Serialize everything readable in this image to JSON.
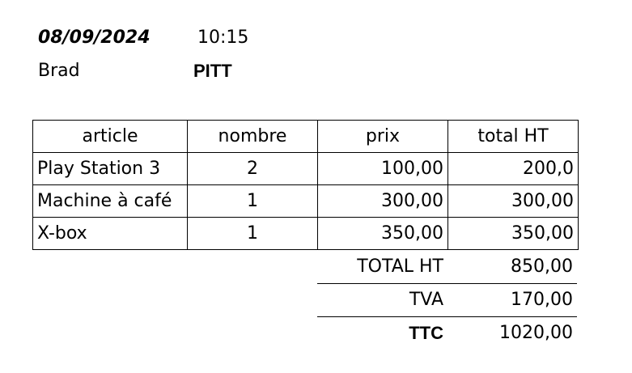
{
  "header": {
    "date": "08/09/2024",
    "time": "10:15",
    "first_name": "Brad",
    "last_name": "PITT"
  },
  "table": {
    "columns": [
      "article",
      "nombre",
      "prix",
      "total HT"
    ],
    "rows": [
      {
        "article": "Play Station 3",
        "nombre": "2",
        "prix": "100,00",
        "total": "200,0"
      },
      {
        "article": "Machine à café",
        "nombre": "1",
        "prix": "300,00",
        "total": "300,00"
      },
      {
        "article": "X-box",
        "nombre": "1",
        "prix": "350,00",
        "total": "350,00"
      }
    ]
  },
  "summary": {
    "total_ht_label": "TOTAL HT",
    "total_ht_value": "850,00",
    "tva_label": "TVA",
    "tva_value": "170,00",
    "ttc_label": "TTC",
    "ttc_value": "1020,00"
  }
}
